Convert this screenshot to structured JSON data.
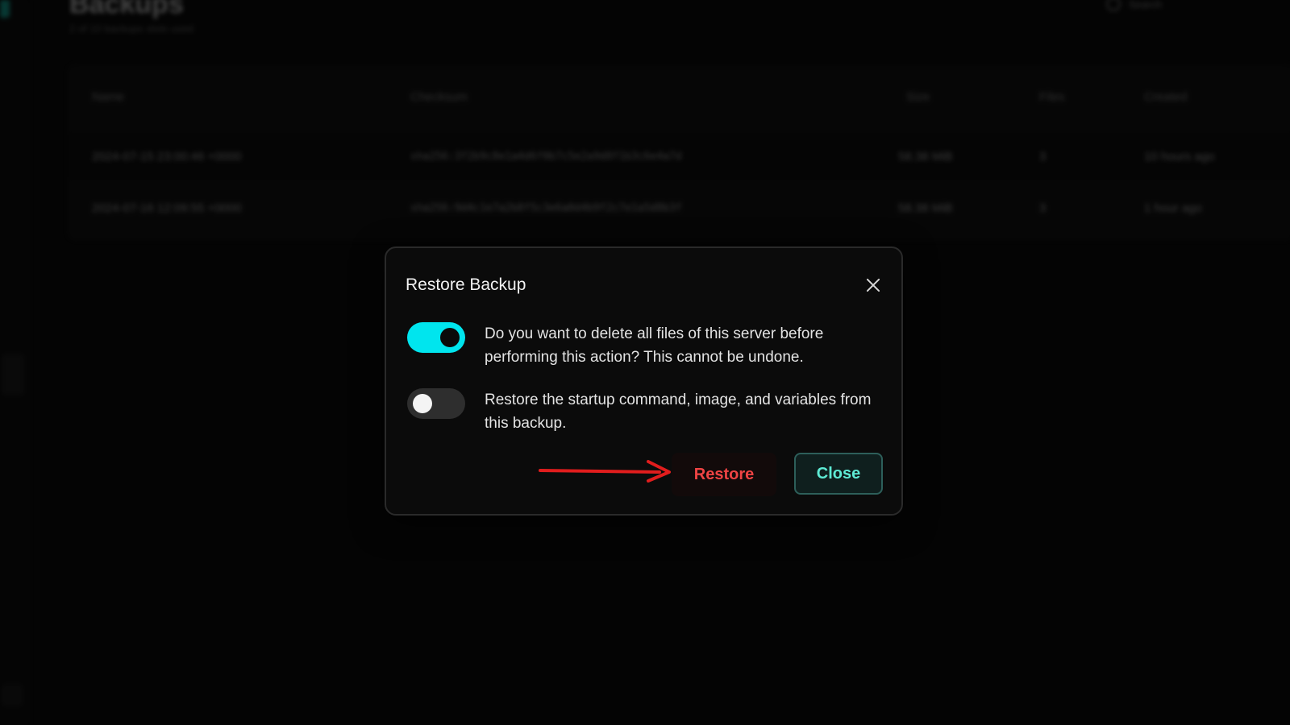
{
  "page": {
    "title": "Backups",
    "subtitle": "2 of 10 backups slots used",
    "search_placeholder": "Search"
  },
  "table": {
    "headers": [
      "Name",
      "Checksum",
      "Size",
      "Files",
      "Created"
    ],
    "rows": [
      {
        "name": "2024-07-15 23:00:46 +0000",
        "checksum": "sha256:3f2b9c8e1a4d6f0b7c5e2a9d8f1b3c6e4a7d",
        "size": "58.38 MiB",
        "files": "3",
        "created": "10 hours ago"
      },
      {
        "name": "2024-07-16 12:09:55 +0000",
        "checksum": "sha256:9d4c1e7a2b8f5c3e6a0d4b9f2c7e1a5d8b3f",
        "size": "58.38 MiB",
        "files": "3",
        "created": "1 hour ago"
      }
    ]
  },
  "modal": {
    "title": "Restore Backup",
    "options": [
      {
        "label": "Do you want to delete all files of this server before performing this action? This cannot be undone.",
        "enabled": true
      },
      {
        "label": "Restore the startup command, image, and variables from this backup.",
        "enabled": false
      }
    ],
    "restore_label": "Restore",
    "close_label": "Close"
  },
  "colors": {
    "accent": "#00e5ee",
    "danger": "#ef4444",
    "close_text": "#5eead4",
    "annotation": "#e11d1d"
  }
}
